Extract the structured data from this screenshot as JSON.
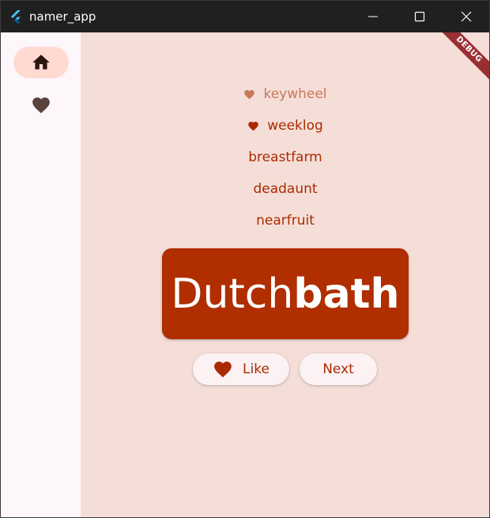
{
  "window": {
    "title": "namer_app",
    "icon": "flutter-logo-icon",
    "controls": [
      "minimize-icon",
      "maximize-icon",
      "close-icon"
    ]
  },
  "colors": {
    "accent": "#b02e00",
    "text_accent": "#ab2b00",
    "background": "#f5ded8",
    "rail_selected": "#ffdad1",
    "debug_ribbon": "#9a2f33"
  },
  "rail": {
    "items": [
      {
        "icon": "home-icon",
        "selected": true
      },
      {
        "icon": "heart-icon",
        "selected": false
      }
    ]
  },
  "debug_banner": "DEBUG",
  "history": [
    {
      "word": "keywheel",
      "favorite": true
    },
    {
      "word": "weeklog",
      "favorite": true
    },
    {
      "word": "breastfarm",
      "favorite": false
    },
    {
      "word": "deadaunt",
      "favorite": false
    },
    {
      "word": "nearfruit",
      "favorite": false
    }
  ],
  "current_pair": {
    "first": "Dutch",
    "second": "bath"
  },
  "actions": {
    "like_label": "Like",
    "next_label": "Next"
  }
}
